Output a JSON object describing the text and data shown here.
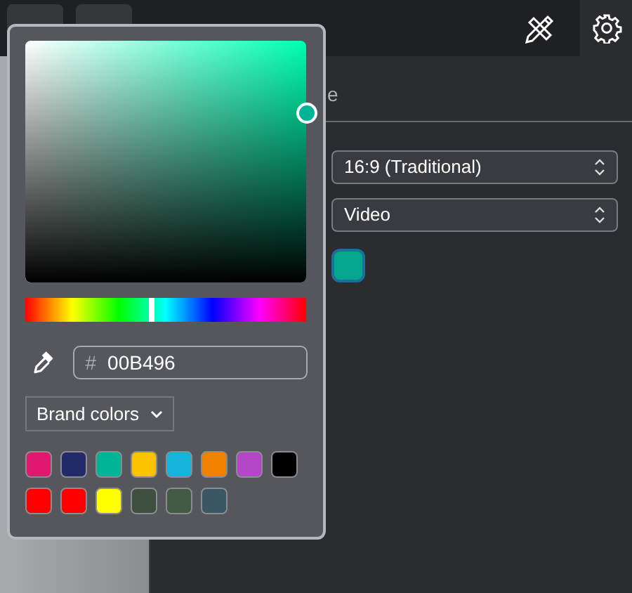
{
  "toolbar": {
    "buttons": [
      {
        "kind": "blank"
      },
      {
        "kind": "blank"
      },
      {
        "kind": "design"
      },
      {
        "kind": "settings",
        "selected": true
      }
    ]
  },
  "panel": {
    "tab_label": "e",
    "dropdowns": [
      {
        "value": "16:9 (Traditional)"
      },
      {
        "value": "Video"
      }
    ],
    "color_swatch": {
      "color": "#04a68d"
    }
  },
  "color_picker": {
    "hue_slider": {
      "level": 0.45
    },
    "hex_prefix": "#",
    "hex_value": "00B496",
    "brand_button": {
      "label": "Brand colors"
    },
    "swatches": [
      {
        "color": "#e0196e"
      },
      {
        "color": "#232a6a"
      },
      {
        "color": "#00b496"
      },
      {
        "color": "#fcc300"
      },
      {
        "color": "#14b4dc"
      },
      {
        "color": "#f08200"
      },
      {
        "color": "#b446c8"
      },
      {
        "color": "#000000"
      },
      {
        "color": "#ff0000"
      },
      {
        "color": "#ff0000"
      },
      {
        "color": "#ffff00"
      },
      {
        "color": "#3f4f3f"
      },
      {
        "color": "#445a44"
      },
      {
        "color": "#3c5764"
      }
    ]
  }
}
